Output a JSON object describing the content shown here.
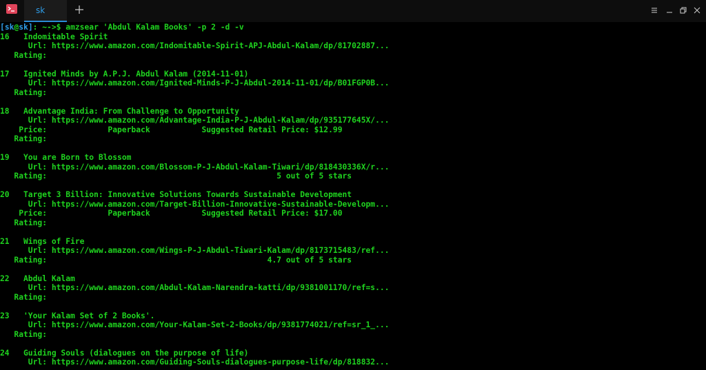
{
  "titlebar": {
    "tab_label": "sk",
    "app_icon": "terminal-icon",
    "new_tab_icon": "plus-icon",
    "controls": [
      "menu-icon",
      "minimize-icon",
      "restore-icon",
      "close-icon"
    ]
  },
  "prompt": {
    "open": "[",
    "user": "sk",
    "at": "@",
    "host": "sk",
    "close": "]",
    "path": ": ~->$ ",
    "command": "amzsear 'Abdul Kalam Books' -p 2 -d -v"
  },
  "output_lines": [
    "16   Indomitable Spirit",
    "      Url: https://www.amazon.com/Indomitable-Spirit-APJ-Abdul-Kalam/dp/81702887...",
    "   Rating:",
    "",
    "17   Ignited Minds by A.P.J. Abdul Kalam (2014-11-01)",
    "      Url: https://www.amazon.com/Ignited-Minds-P-J-Abdul-2014-11-01/dp/B01FGP0B...",
    "   Rating:",
    "",
    "18   Advantage India: From Challenge to Opportunity",
    "      Url: https://www.amazon.com/Advantage-India-P-J-Abdul-Kalam/dp/935177645X/...",
    "    Price:             Paperback           Suggested Retail Price: $12.99",
    "   Rating:",
    "",
    "19   You are Born to Blossom",
    "      Url: https://www.amazon.com/Blossom-P-J-Abdul-Kalam-Tiwari/dp/818430336X/r...",
    "   Rating:                                                 5 out of 5 stars",
    "",
    "20   Target 3 Billion: Innovative Solutions Towards Sustainable Development",
    "      Url: https://www.amazon.com/Target-Billion-Innovative-Sustainable-Developm...",
    "    Price:             Paperback           Suggested Retail Price: $17.00",
    "   Rating:",
    "",
    "21   Wings of Fire",
    "      Url: https://www.amazon.com/Wings-P-J-Abdul-Tiwari-Kalam/dp/8173715483/ref...",
    "   Rating:                                               4.7 out of 5 stars",
    "",
    "22   Abdul Kalam",
    "      Url: https://www.amazon.com/Abdul-Kalam-Narendra-katti/dp/9381001170/ref=s...",
    "   Rating:",
    "",
    "23   'Your Kalam Set of 2 Books'.",
    "      Url: https://www.amazon.com/Your-Kalam-Set-2-Books/dp/9381774021/ref=sr_1_...",
    "   Rating:",
    "",
    "24   Guiding Souls (dialogues on the purpose of life)",
    "      Url: https://www.amazon.com/Guiding-Souls-dialogues-purpose-life/dp/818832..."
  ]
}
